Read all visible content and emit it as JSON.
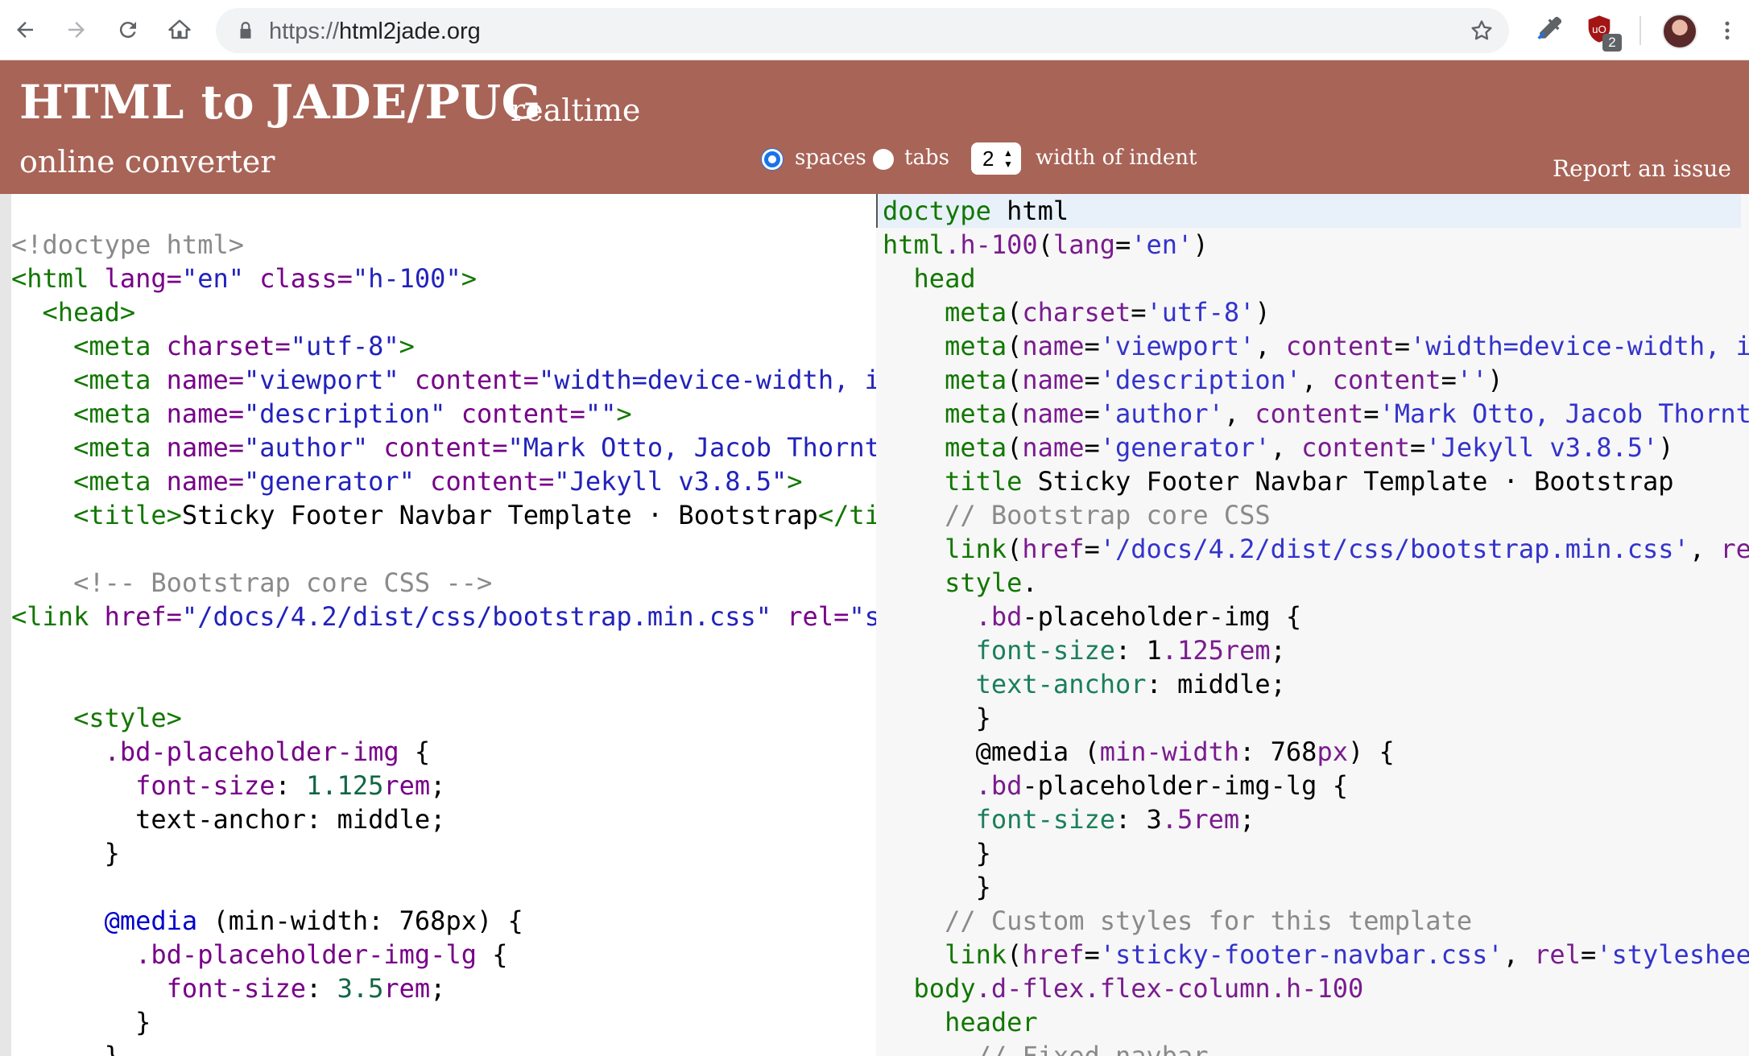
{
  "browser": {
    "url_protocol": "https://",
    "url_host": "html2jade.org",
    "extension_badge": "2"
  },
  "header": {
    "title": "HTML to JADE/PUG",
    "title_suffix": "realtime",
    "subtitle": "online converter",
    "option_spaces": "spaces",
    "option_tabs": "tabs",
    "indent_value": "2",
    "indent_label": "width of indent",
    "report_link": "Report an issue"
  },
  "colors": {
    "header_bg": "#a86457",
    "radio_accent": "#1a73e8"
  },
  "html_editor": {
    "lines": [
      [],
      [
        [
          "c",
          "<!doctype html>"
        ]
      ],
      [
        [
          "t",
          "<html "
        ],
        [
          "a",
          "lang="
        ],
        [
          "s",
          "\"en\" "
        ],
        [
          "a",
          "class="
        ],
        [
          "s",
          "\"h-100\""
        ],
        [
          "t",
          ">"
        ]
      ],
      [
        [
          "k",
          "  "
        ],
        [
          "t",
          "<head>"
        ]
      ],
      [
        [
          "k",
          "    "
        ],
        [
          "t",
          "<meta "
        ],
        [
          "a",
          "charset="
        ],
        [
          "s",
          "\"utf-8\""
        ],
        [
          "t",
          ">"
        ]
      ],
      [
        [
          "k",
          "    "
        ],
        [
          "t",
          "<meta "
        ],
        [
          "a",
          "name="
        ],
        [
          "s",
          "\"viewport\" "
        ],
        [
          "a",
          "content="
        ],
        [
          "s",
          "\"width=device-width, i"
        ]
      ],
      [
        [
          "k",
          "    "
        ],
        [
          "t",
          "<meta "
        ],
        [
          "a",
          "name="
        ],
        [
          "s",
          "\"description\" "
        ],
        [
          "a",
          "content="
        ],
        [
          "s",
          "\"\""
        ],
        [
          "t",
          ">"
        ]
      ],
      [
        [
          "k",
          "    "
        ],
        [
          "t",
          "<meta "
        ],
        [
          "a",
          "name="
        ],
        [
          "s",
          "\"author\" "
        ],
        [
          "a",
          "content="
        ],
        [
          "s",
          "\"Mark Otto, Jacob Thornt"
        ]
      ],
      [
        [
          "k",
          "    "
        ],
        [
          "t",
          "<meta "
        ],
        [
          "a",
          "name="
        ],
        [
          "s",
          "\"generator\" "
        ],
        [
          "a",
          "content="
        ],
        [
          "s",
          "\"Jekyll v3.8.5\""
        ],
        [
          "t",
          ">"
        ]
      ],
      [
        [
          "k",
          "    "
        ],
        [
          "t",
          "<title>"
        ],
        [
          "k",
          "Sticky Footer Navbar Template · Bootstrap"
        ],
        [
          "t",
          "</ti"
        ]
      ],
      [],
      [
        [
          "k",
          "    "
        ],
        [
          "c",
          "<!-- Bootstrap core CSS -->"
        ]
      ],
      [
        [
          "t",
          "<link "
        ],
        [
          "a",
          "href="
        ],
        [
          "s",
          "\"/docs/4.2/dist/css/bootstrap.min.css\" "
        ],
        [
          "a",
          "rel="
        ],
        [
          "s",
          "\"s"
        ]
      ],
      [],
      [],
      [
        [
          "k",
          "    "
        ],
        [
          "t",
          "<style>"
        ]
      ],
      [
        [
          "k",
          "      "
        ],
        [
          "a",
          ".bd-placeholder-img"
        ],
        [
          "k",
          " {"
        ]
      ],
      [
        [
          "k",
          "        "
        ],
        [
          "a",
          "font-size"
        ],
        [
          "k",
          ": "
        ],
        [
          "n",
          "1.125"
        ],
        [
          "a",
          "rem"
        ],
        [
          "k",
          ";"
        ]
      ],
      [
        [
          "k",
          "        text-anchor: middle;"
        ]
      ],
      [
        [
          "k",
          "      }"
        ]
      ],
      [],
      [
        [
          "k",
          "      "
        ],
        [
          "d",
          "@media"
        ],
        [
          "k",
          " (min-width: 768px) {"
        ]
      ],
      [
        [
          "k",
          "        "
        ],
        [
          "a",
          ".bd-placeholder-img-lg"
        ],
        [
          "k",
          " {"
        ]
      ],
      [
        [
          "k",
          "          "
        ],
        [
          "a",
          "font-size"
        ],
        [
          "k",
          ": "
        ],
        [
          "n",
          "3.5"
        ],
        [
          "a",
          "rem"
        ],
        [
          "k",
          ";"
        ]
      ],
      [
        [
          "k",
          "        }"
        ]
      ],
      [
        [
          "k",
          "      }"
        ]
      ]
    ]
  },
  "pug_editor": {
    "lines": [
      [
        [
          "pt",
          "doctype"
        ],
        [
          "k",
          " html"
        ]
      ],
      [
        [
          "pt",
          "html"
        ],
        [
          "pc",
          ".h-100"
        ],
        [
          "k",
          "("
        ],
        [
          "pa",
          "lang"
        ],
        [
          "k",
          "="
        ],
        [
          "ps",
          "'en'"
        ],
        [
          "k",
          ")"
        ]
      ],
      [
        [
          "k",
          "  "
        ],
        [
          "pt",
          "head"
        ]
      ],
      [
        [
          "k",
          "    "
        ],
        [
          "pt",
          "meta"
        ],
        [
          "k",
          "("
        ],
        [
          "pa",
          "charset"
        ],
        [
          "k",
          "="
        ],
        [
          "ps",
          "'utf-8'"
        ],
        [
          "k",
          ")"
        ]
      ],
      [
        [
          "k",
          "    "
        ],
        [
          "pt",
          "meta"
        ],
        [
          "k",
          "("
        ],
        [
          "pa",
          "name"
        ],
        [
          "k",
          "="
        ],
        [
          "ps",
          "'viewport'"
        ],
        [
          "k",
          ", "
        ],
        [
          "pa",
          "content"
        ],
        [
          "k",
          "="
        ],
        [
          "ps",
          "'width=device-width, i"
        ]
      ],
      [
        [
          "k",
          "    "
        ],
        [
          "pt",
          "meta"
        ],
        [
          "k",
          "("
        ],
        [
          "pa",
          "name"
        ],
        [
          "k",
          "="
        ],
        [
          "ps",
          "'description'"
        ],
        [
          "k",
          ", "
        ],
        [
          "pa",
          "content"
        ],
        [
          "k",
          "="
        ],
        [
          "ps",
          "''"
        ],
        [
          "k",
          ")"
        ]
      ],
      [
        [
          "k",
          "    "
        ],
        [
          "pt",
          "meta"
        ],
        [
          "k",
          "("
        ],
        [
          "pa",
          "name"
        ],
        [
          "k",
          "="
        ],
        [
          "ps",
          "'author'"
        ],
        [
          "k",
          ", "
        ],
        [
          "pa",
          "content"
        ],
        [
          "k",
          "="
        ],
        [
          "ps",
          "'Mark Otto, Jacob Thornt"
        ]
      ],
      [
        [
          "k",
          "    "
        ],
        [
          "pt",
          "meta"
        ],
        [
          "k",
          "("
        ],
        [
          "pa",
          "name"
        ],
        [
          "k",
          "="
        ],
        [
          "ps",
          "'generator'"
        ],
        [
          "k",
          ", "
        ],
        [
          "pa",
          "content"
        ],
        [
          "k",
          "="
        ],
        [
          "ps",
          "'Jekyll v3.8.5'"
        ],
        [
          "k",
          ")"
        ]
      ],
      [
        [
          "k",
          "    "
        ],
        [
          "pt",
          "title"
        ],
        [
          "k",
          " Sticky Footer Navbar Template · Bootstrap"
        ]
      ],
      [
        [
          "k",
          "    "
        ],
        [
          "pm",
          "// Bootstrap core CSS"
        ]
      ],
      [
        [
          "k",
          "    "
        ],
        [
          "pt",
          "link"
        ],
        [
          "k",
          "("
        ],
        [
          "pa",
          "href"
        ],
        [
          "k",
          "="
        ],
        [
          "ps",
          "'/docs/4.2/dist/css/bootstrap.min.css'"
        ],
        [
          "k",
          ", "
        ],
        [
          "pa",
          "re"
        ]
      ],
      [
        [
          "k",
          "    "
        ],
        [
          "pt",
          "style"
        ],
        [
          "k",
          "."
        ]
      ],
      [
        [
          "k",
          "      "
        ],
        [
          "pc",
          ".bd"
        ],
        [
          "k",
          "-placeholder-img {"
        ]
      ],
      [
        [
          "k",
          "      "
        ],
        [
          "pp",
          "font-size"
        ],
        [
          "k",
          ": 1"
        ],
        [
          "pc",
          ".125rem"
        ],
        [
          "k",
          ";"
        ]
      ],
      [
        [
          "k",
          "      "
        ],
        [
          "pp",
          "text-anchor"
        ],
        [
          "k",
          ": middle;"
        ]
      ],
      [
        [
          "k",
          "      }"
        ]
      ],
      [
        [
          "k",
          "      @media ("
        ],
        [
          "pa",
          "min-width"
        ],
        [
          "k",
          ": 768"
        ],
        [
          "pa",
          "px"
        ],
        [
          "k",
          ") {"
        ]
      ],
      [
        [
          "k",
          "      "
        ],
        [
          "pc",
          ".bd"
        ],
        [
          "k",
          "-placeholder-img-lg {"
        ]
      ],
      [
        [
          "k",
          "      "
        ],
        [
          "pp",
          "font-size"
        ],
        [
          "k",
          ": 3"
        ],
        [
          "pc",
          ".5rem"
        ],
        [
          "k",
          ";"
        ]
      ],
      [
        [
          "k",
          "      }"
        ]
      ],
      [
        [
          "k",
          "      }"
        ]
      ],
      [
        [
          "k",
          "    "
        ],
        [
          "pm",
          "// Custom styles for this template"
        ]
      ],
      [
        [
          "k",
          "    "
        ],
        [
          "pt",
          "link"
        ],
        [
          "k",
          "("
        ],
        [
          "pa",
          "href"
        ],
        [
          "k",
          "="
        ],
        [
          "ps",
          "'sticky-footer-navbar.css'"
        ],
        [
          "k",
          ", "
        ],
        [
          "pa",
          "rel"
        ],
        [
          "k",
          "="
        ],
        [
          "ps",
          "'styleshee"
        ]
      ],
      [
        [
          "k",
          "  "
        ],
        [
          "pt",
          "body"
        ],
        [
          "pc",
          ".d-flex.flex-column.h-100"
        ]
      ],
      [
        [
          "k",
          "    "
        ],
        [
          "pt",
          "header"
        ]
      ],
      [
        [
          "k",
          "      "
        ],
        [
          "pm",
          "// Fixed navbar"
        ]
      ]
    ]
  }
}
